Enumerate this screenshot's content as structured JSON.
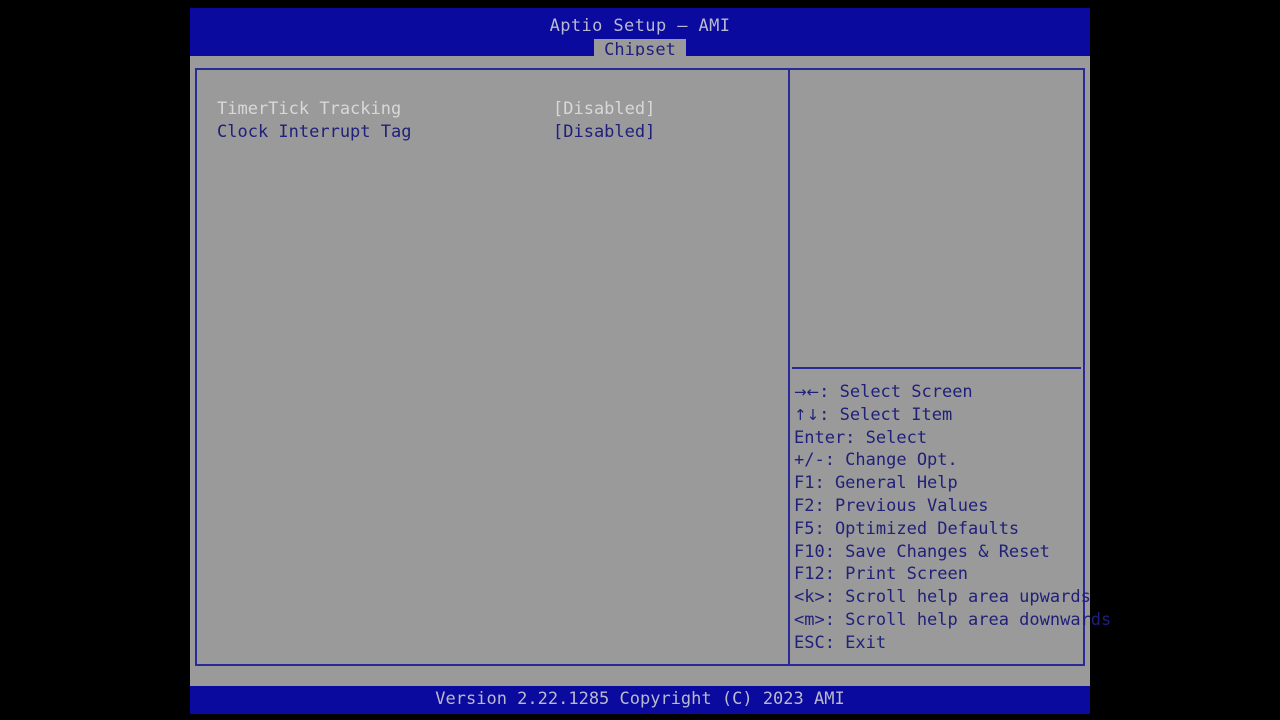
{
  "header": {
    "app_title": "Aptio Setup – AMI",
    "tabs": [
      {
        "label": "Chipset",
        "selected": true
      }
    ]
  },
  "settings": {
    "rows": [
      {
        "label": "TimerTick Tracking",
        "value": "[Disabled]",
        "state": "dimmed"
      },
      {
        "label": "Clock Interrupt Tag",
        "value": "[Disabled]",
        "state": "active"
      }
    ]
  },
  "help": {
    "description": "",
    "keys": [
      {
        "glyph": "→←",
        "text": ": Select Screen"
      },
      {
        "glyph": "↑↓",
        "text": ": Select Item"
      },
      {
        "glyph": "",
        "text": "Enter: Select"
      },
      {
        "glyph": "",
        "text": "+/-: Change Opt."
      },
      {
        "glyph": "",
        "text": "F1: General Help"
      },
      {
        "glyph": "",
        "text": "F2: Previous Values"
      },
      {
        "glyph": "",
        "text": "F5: Optimized Defaults"
      },
      {
        "glyph": "",
        "text": "F10: Save Changes & Reset"
      },
      {
        "glyph": "",
        "text": "F12: Print Screen"
      },
      {
        "glyph": "",
        "text": "<k>: Scroll help area upwards"
      },
      {
        "glyph": "",
        "text": "<m>: Scroll help area downwards"
      },
      {
        "glyph": "",
        "text": "ESC: Exit"
      }
    ]
  },
  "footer": {
    "version": "Version 2.22.1285 Copyright (C) 2023 AMI"
  },
  "colors": {
    "header_blue": "#0a0a9e",
    "panel_gray": "#9a9a9a",
    "border_blue": "#2a2a96",
    "text_blue": "#20207a",
    "text_dim": "#d8d8d8",
    "text_light": "#b9b9cf"
  }
}
